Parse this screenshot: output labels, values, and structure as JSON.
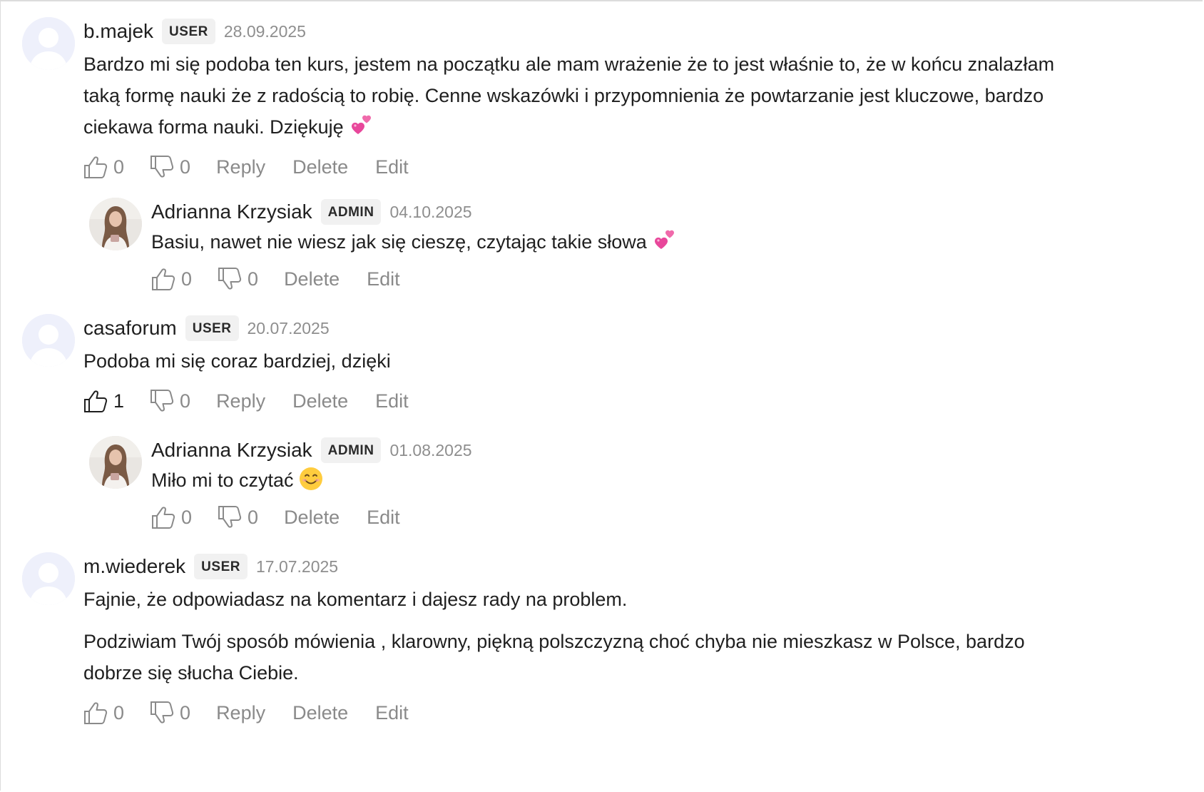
{
  "comments": [
    {
      "author": "b.majek",
      "role": "USER",
      "date": "28.09.2025",
      "text_lines": [
        "Bardzo mi się podoba ten kurs, jestem na początku ale mam wrażenie że to jest właśnie to, że w końcu znalazłam",
        "taką formę nauki że z radością to robię. Cenne wskazówki i przypomnienia że powtarzanie jest kluczowe, bardzo",
        "ciekawa forma nauki. Dziękuję"
      ],
      "emoji": "two-hearts",
      "likes": "0",
      "dislikes": "0",
      "reply_label": "Reply",
      "delete_label": "Delete",
      "edit_label": "Edit",
      "reply": {
        "author": "Adrianna Krzysiak",
        "role": "ADMIN",
        "date": "04.10.2025",
        "text": "Basiu, nawet nie wiesz jak się cieszę, czytając takie słowa",
        "emoji": "two-hearts",
        "likes": "0",
        "dislikes": "0",
        "delete_label": "Delete",
        "edit_label": "Edit"
      }
    },
    {
      "author": "casaforum",
      "role": "USER",
      "date": "20.07.2025",
      "text": "Podoba mi się coraz bardziej, dzięki",
      "likes": "1",
      "dislikes": "0",
      "liked": true,
      "reply_label": "Reply",
      "delete_label": "Delete",
      "edit_label": "Edit",
      "reply": {
        "author": "Adrianna Krzysiak",
        "role": "ADMIN",
        "date": "01.08.2025",
        "text": "Miło mi to czytać",
        "emoji": "smiling-face",
        "likes": "0",
        "dislikes": "0",
        "delete_label": "Delete",
        "edit_label": "Edit"
      }
    },
    {
      "author": "m.wiederek",
      "role": "USER",
      "date": "17.07.2025",
      "paragraph1": "Fajnie, że odpowiadasz na komentarz i dajesz rady na problem.",
      "paragraph2_lines": [
        "Podziwiam Twój sposób mówienia , klarowny, piękną polszczyzną choć chyba nie mieszkasz w Polsce, bardzo",
        "dobrze się słucha Ciebie."
      ],
      "likes": "0",
      "dislikes": "0",
      "reply_label": "Reply",
      "delete_label": "Delete",
      "edit_label": "Edit"
    }
  ],
  "colors": {
    "text": "#1f1f1f",
    "muted": "#8a8a8a",
    "badge_bg": "#f1f1f1",
    "avatar_default": "#eef0fb"
  }
}
